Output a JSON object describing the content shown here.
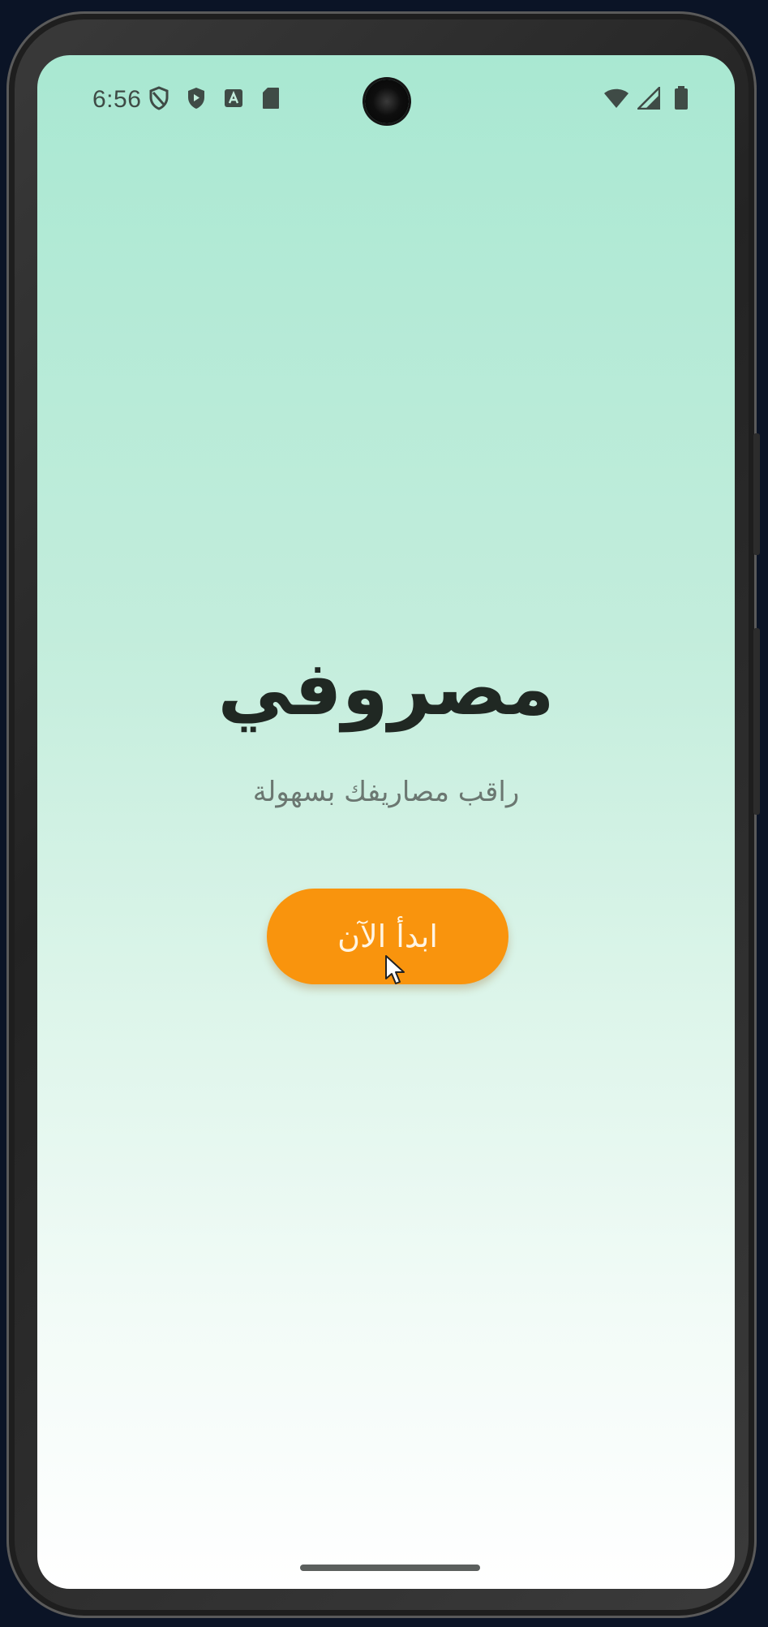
{
  "status_bar": {
    "time": "6:56",
    "left_icons": [
      "privacy-shield-icon",
      "security-shield-icon",
      "app-notification-icon",
      "sd-card-icon"
    ],
    "right_icons": [
      "wifi-icon",
      "cellular-signal-icon",
      "battery-icon"
    ]
  },
  "main": {
    "title": "مصروفي",
    "subtitle": "راقب مصاريفك بسهولة",
    "start_button_label": "ابدأ الآن"
  },
  "colors": {
    "gradient_top": "#a9e8d2",
    "gradient_bottom": "#ffffff",
    "button": "#f9940d",
    "title_text": "#202823",
    "subtitle_text": "#6b7771"
  }
}
